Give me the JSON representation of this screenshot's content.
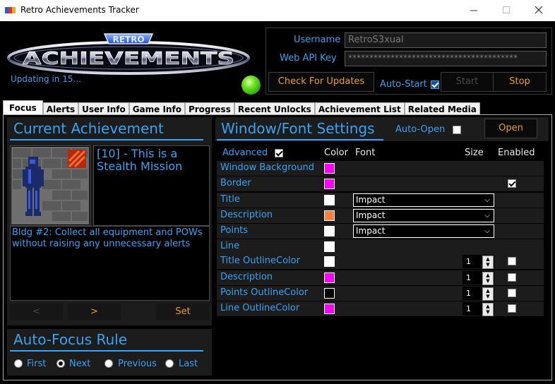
{
  "window": {
    "title": "Retro Achievements Tracker",
    "minimize_icon": "minimize-icon",
    "maximize_icon": "maximize-icon",
    "close_icon": "close-icon"
  },
  "logo": {
    "top_text": "RETRO",
    "main_text": "ACHIEVEMENTS"
  },
  "status": {
    "updating_text": "Updating in 15...",
    "led_color": "#55d020"
  },
  "login": {
    "username_label": "Username",
    "username_value": "RetroS3xual",
    "api_key_label": "Web API Key",
    "api_key_value": "****************************************",
    "check_updates_label": "Check For Updates",
    "auto_start_label": "Auto-Start",
    "auto_start_checked": true,
    "start_label": "Start",
    "stop_label": "Stop"
  },
  "tabs": [
    {
      "label": "Focus",
      "active": true
    },
    {
      "label": "Alerts"
    },
    {
      "label": "User Info"
    },
    {
      "label": "Game Info"
    },
    {
      "label": "Progress"
    },
    {
      "label": "Recent Unlocks"
    },
    {
      "label": "Achievement List"
    },
    {
      "label": "Related Media"
    }
  ],
  "current_achievement": {
    "heading": "Current Achievement",
    "title": "[10] - This is a Stealth Mission",
    "description": "Bldg #2: Collect all equipment and POWs without raising any unnecessary alerts",
    "prev_label": "<",
    "next_label": ">",
    "set_label": "Set"
  },
  "auto_focus": {
    "heading": "Auto-Focus Rule",
    "options": [
      {
        "label": "First",
        "selected": false
      },
      {
        "label": "Next",
        "selected": true
      },
      {
        "label": "Previous",
        "selected": false
      },
      {
        "label": "Last",
        "selected": false
      }
    ]
  },
  "window_font_settings": {
    "heading": "Window/Font Settings",
    "auto_open_label": "Auto-Open",
    "auto_open_checked": false,
    "open_label": "Open",
    "advanced_label": "Advanced",
    "advanced_checked": true,
    "columns": {
      "color": "Color",
      "font": "Font",
      "size": "Size",
      "enabled": "Enabled"
    },
    "rows": [
      {
        "label": "Window Background",
        "color": "#ff00ff"
      },
      {
        "label": "Border",
        "color": "#ff00ff",
        "enabled": true
      },
      {
        "label": "Title",
        "color": "#ffffff",
        "font": "Impact"
      },
      {
        "label": "Description",
        "color": "#ff7f3f",
        "font": "Impact"
      },
      {
        "label": "Points",
        "color": "#ffffff",
        "font": "Impact"
      },
      {
        "label": "Line",
        "color": "#ffffff"
      },
      {
        "label": "Title OutlineColor",
        "color": "#ffffff",
        "size": "1",
        "enabled": false
      },
      {
        "label": "Description",
        "color": "#ff00ff",
        "size": "1",
        "enabled": false
      },
      {
        "label": "Points OutlineColor",
        "color": "#000000",
        "size": "1",
        "enabled": false
      },
      {
        "label": "Line OutlineColor",
        "color": "#ff00ff",
        "size": "1",
        "enabled": false
      }
    ]
  },
  "colors": {
    "accent_blue": "#3aa2f2",
    "accent_orange": "#e8a020",
    "panel_bg": "#1c1c1c"
  }
}
